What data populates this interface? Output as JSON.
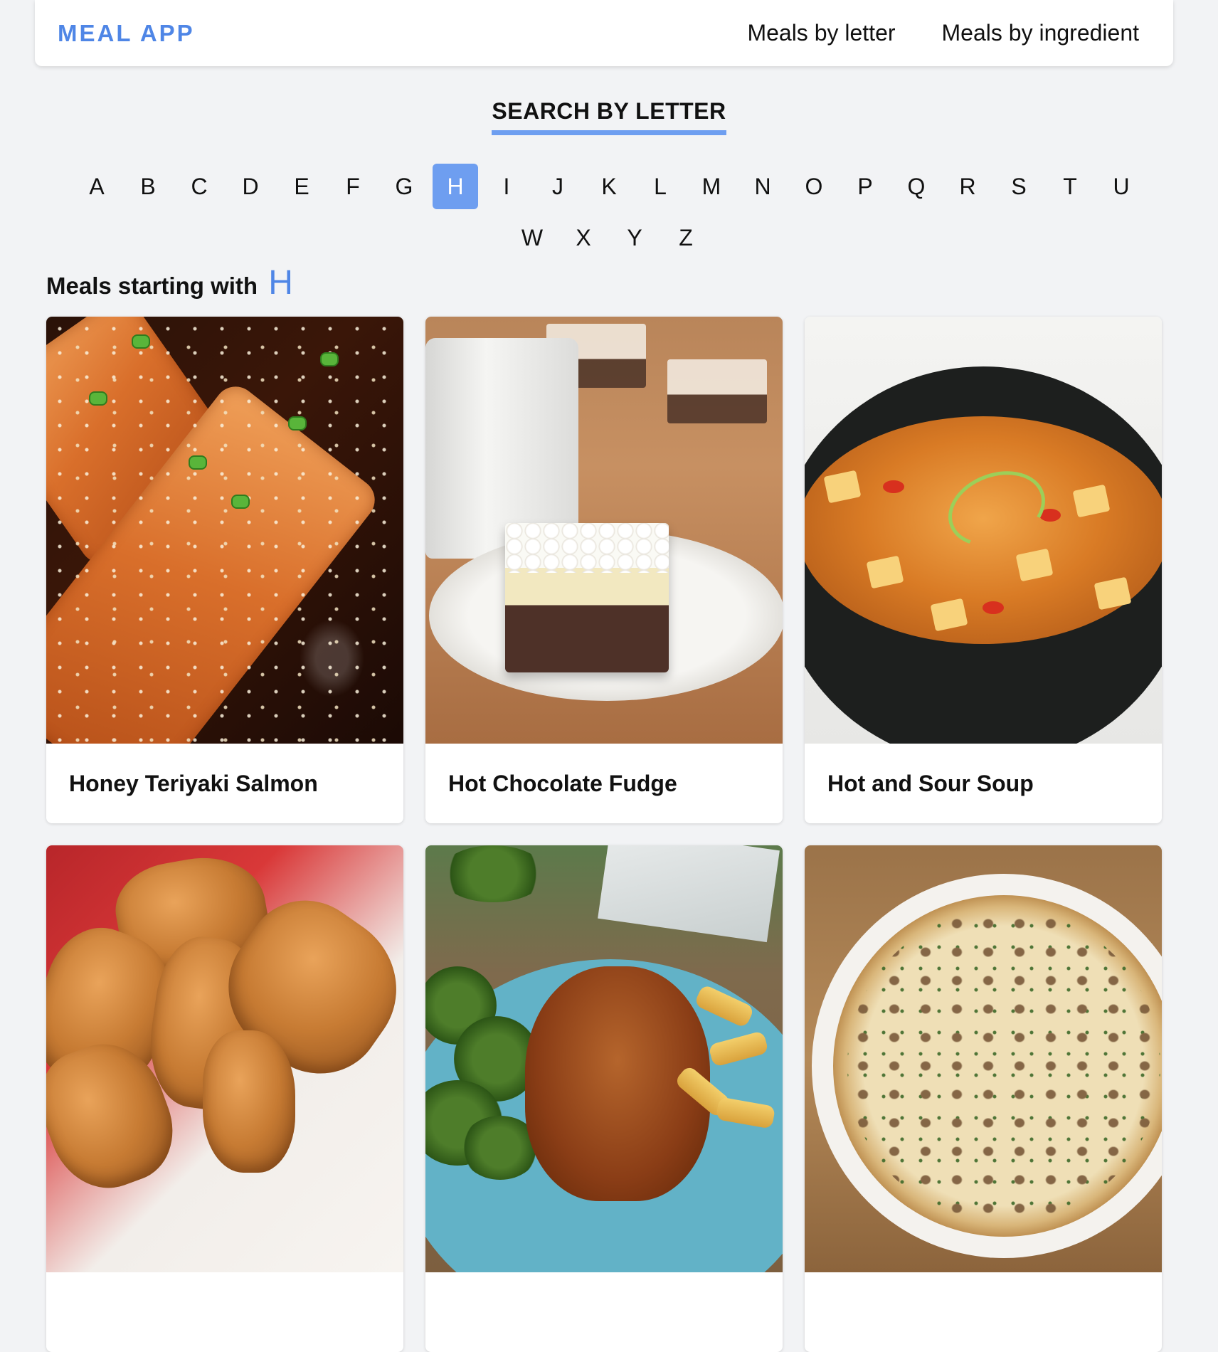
{
  "header": {
    "brand": "MEAL APP",
    "nav": [
      {
        "label": "Meals by letter"
      },
      {
        "label": "Meals by ingredient"
      }
    ]
  },
  "search": {
    "title": "SEARCH BY LETTER",
    "letters_row1": [
      "A",
      "B",
      "C",
      "D",
      "E",
      "F",
      "G",
      "H",
      "I",
      "J",
      "K",
      "L",
      "M",
      "N",
      "O",
      "P",
      "Q",
      "R",
      "S",
      "T",
      "U"
    ],
    "letters_row2": [
      "W",
      "X",
      "Y",
      "Z"
    ],
    "selected_letter": "H",
    "accent_color": "#6e9ef0"
  },
  "results": {
    "heading": "Meals starting with",
    "letter": "H",
    "meals": [
      {
        "title": "Honey Teriyaki Salmon",
        "image": "salmon-photo"
      },
      {
        "title": "Hot Chocolate Fudge",
        "image": "fudge-photo"
      },
      {
        "title": "Hot and Sour Soup",
        "image": "soup-photo"
      },
      {
        "title": "",
        "image": "fried-dough-photo"
      },
      {
        "title": "",
        "image": "chicken-broccoli-photo"
      },
      {
        "title": "",
        "image": "tart-photo"
      }
    ]
  },
  "colors": {
    "brand": "#4f86e6",
    "background": "#f2f3f5",
    "card": "#ffffff"
  }
}
